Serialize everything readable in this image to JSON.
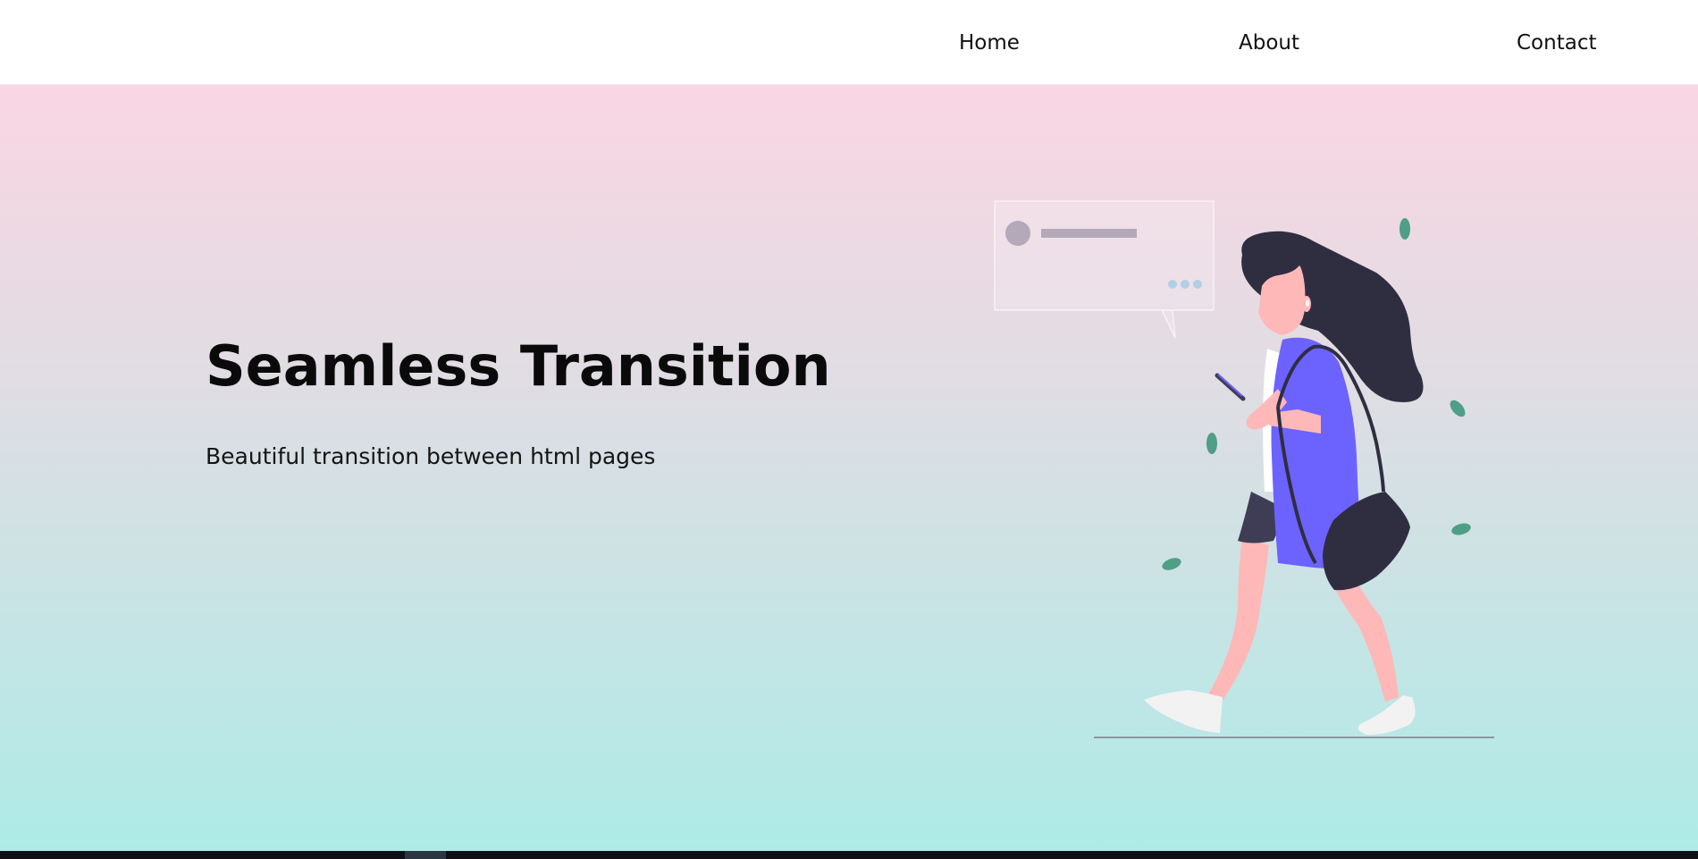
{
  "nav": {
    "home": "Home",
    "about": "About",
    "contact": "Contact"
  },
  "hero": {
    "title": "Seamless Transition",
    "subtitle": "Beautiful transition between html pages"
  },
  "colors": {
    "gradient_top": "#fad6e3",
    "gradient_bottom": "#aeebe7",
    "accent": "#6c63ff",
    "hair": "#2f2e41",
    "skin": "#ffb8b8",
    "leaf": "#4f9e86",
    "footer": "#0d1117"
  },
  "illustration": {
    "name": "woman-walking-with-phone"
  }
}
